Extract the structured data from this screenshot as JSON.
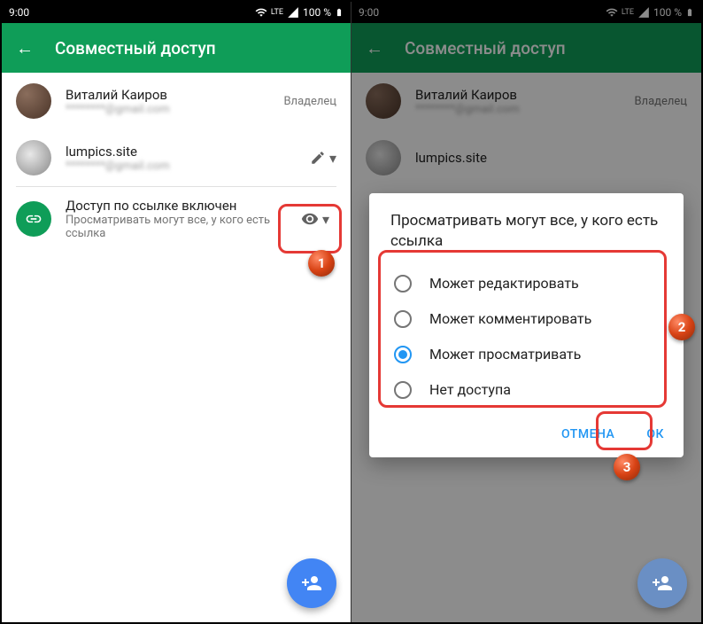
{
  "status": {
    "time": "9:00",
    "network": "LTE",
    "battery": "100 %"
  },
  "appbar": {
    "title": "Совместный доступ"
  },
  "people": [
    {
      "name": "Виталий Каиров",
      "email_masked": "********@gmail.com",
      "role": "Владелец"
    },
    {
      "name": "lumpics.site",
      "email_masked": "********@gmail.com"
    }
  ],
  "link_access": {
    "title": "Доступ по ссылке включен",
    "desc": "Просматривать могут все, у кого есть ссылка"
  },
  "dialog": {
    "title": "Просматривать могут все, у кого есть ссылка",
    "options": [
      {
        "label": "Может редактировать",
        "selected": false
      },
      {
        "label": "Может комментировать",
        "selected": false
      },
      {
        "label": "Может просматривать",
        "selected": true
      },
      {
        "label": "Нет доступа",
        "selected": false
      }
    ],
    "cancel": "ОТМЕНА",
    "ok": "ОК"
  },
  "markers": {
    "m1": "1",
    "m2": "2",
    "m3": "3"
  }
}
